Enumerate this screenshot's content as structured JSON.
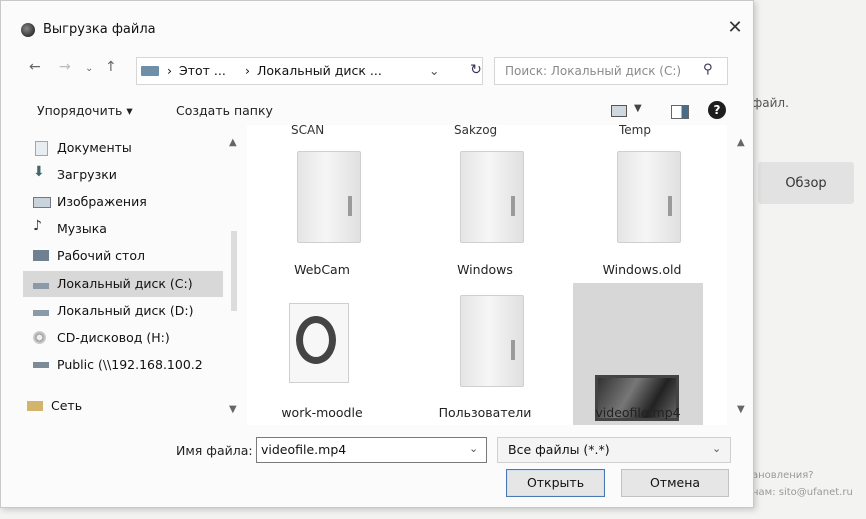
{
  "background": {
    "instruction_fragment": "файл.",
    "browse_label": "Обзор",
    "footer_line1": "ановления?",
    "footer_line2": "нам: sito@ufanet.ru"
  },
  "dialog": {
    "title": "Выгрузка файла",
    "close": "✕",
    "address": {
      "seg1": "Этот ...",
      "sep": "›",
      "seg2": "Локальный диск ...",
      "dropdown": "⌄",
      "refresh": "↻"
    },
    "search_placeholder": "Поиск: Локальный диск (C:)",
    "toolbar": {
      "organize": "Упорядочить ▾",
      "new_folder": "Создать папку"
    },
    "nav_items": [
      {
        "label": "Документы",
        "icon": "documents-icon"
      },
      {
        "label": "Загрузки",
        "icon": "downloads-icon"
      },
      {
        "label": "Изображения",
        "icon": "pictures-icon"
      },
      {
        "label": "Музыка",
        "icon": "music-icon"
      },
      {
        "label": "Рабочий стол",
        "icon": "desktop-icon"
      },
      {
        "label": "Локальный диск (C:)",
        "icon": "drive-icon",
        "selected": true
      },
      {
        "label": "Локальный диск (D:)",
        "icon": "drive-icon"
      },
      {
        "label": "CD-дисковод (H:)",
        "icon": "cd-drive-icon"
      },
      {
        "label": "Public (\\\\192.168.100.2",
        "icon": "network-drive-icon"
      },
      {
        "label": "Сеть",
        "icon": "network-icon"
      }
    ],
    "cut_labels": [
      "SCAN",
      "Sakzog",
      "Temp"
    ],
    "files": [
      {
        "name": "WebCam",
        "type": "folder"
      },
      {
        "name": "Windows",
        "type": "folder"
      },
      {
        "name": "Windows.old",
        "type": "folder"
      },
      {
        "name": "work-moodle",
        "type": "moodle"
      },
      {
        "name": "Пользователи",
        "type": "folder"
      },
      {
        "name": "videofile.mp4",
        "type": "video",
        "selected": true
      }
    ],
    "filename_label": "Имя файла:",
    "filename_value": "videofile.mp4",
    "filetype_value": "Все файлы (*.*)",
    "open_button": "Открыть",
    "cancel_button": "Отмена"
  },
  "colors": {
    "selection": "#d7d7d7",
    "focus_border": "#4a78b5"
  }
}
